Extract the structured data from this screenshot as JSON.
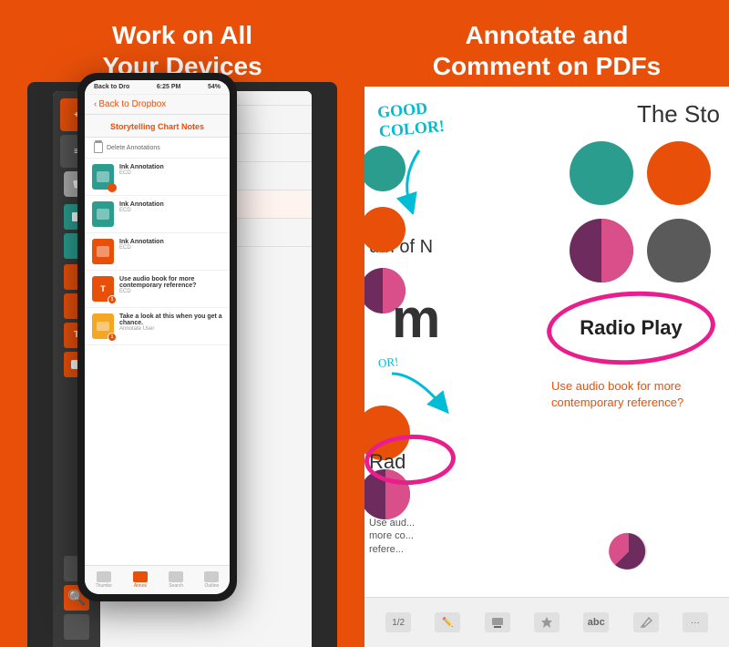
{
  "left": {
    "title_line1": "Work on All",
    "title_line2": "Your Devices",
    "phone": {
      "status_left": "Back to Dro",
      "status_time": "6:25 PM",
      "status_battery": "54%",
      "nav_back": "Back to Dropbox",
      "nav_title": "Storytelling Chart Notes",
      "action_label": "Delete Annotations",
      "annotations": [
        {
          "label": "Ink Annotation",
          "sub": "ECD",
          "color": "teal",
          "badge": ""
        },
        {
          "label": "Ink Annotation",
          "sub": "ECD",
          "color": "teal",
          "badge": ""
        },
        {
          "label": "Ink Annotation",
          "sub": "ECD",
          "color": "orange",
          "badge": ""
        },
        {
          "label": "Use audio book for more contemporary reference?",
          "sub": "ECD",
          "color": "orange",
          "badge": "1"
        },
        {
          "label": "Take a look at this when you get a chance.",
          "sub": "Annotate User",
          "color": "orange",
          "badge": "1"
        }
      ],
      "tabs": [
        "Thumbs",
        "Annos",
        "Search",
        "Outline"
      ]
    }
  },
  "right": {
    "title_line1": "Annotate and",
    "title_line2": "Comment on PDFs",
    "pdf": {
      "title": "The Sto",
      "handwritten": "GOOD COLOR!",
      "radio_play": "Radio Play",
      "comment": "Use audio book for more contemporary reference?",
      "page_num": "1/2",
      "toolbar_items": [
        "pencil",
        "pencil2",
        "stamp",
        "abc",
        "pen",
        "more"
      ],
      "use_audio_partial": "Use aud... more co... refere..."
    }
  }
}
